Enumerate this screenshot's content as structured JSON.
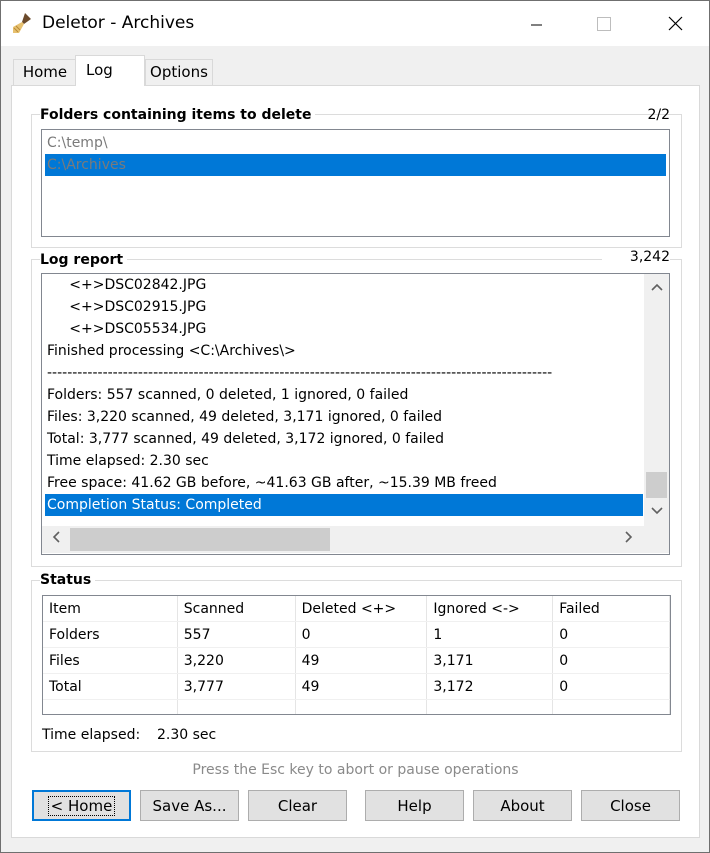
{
  "window": {
    "title": "Deletor - Archives"
  },
  "tabs": [
    {
      "label": "Home",
      "active": false
    },
    {
      "label": "Log",
      "active": true
    },
    {
      "label": "Options",
      "active": false
    }
  ],
  "folders": {
    "label": "Folders containing items to delete",
    "count": "2/2",
    "items": [
      "C:\\temp\\",
      "C:\\Archives"
    ],
    "selected_index": 1
  },
  "log": {
    "label": "Log report",
    "count": "3,242",
    "lines": [
      "     <+>DSC02842.JPG",
      "     <+>DSC02915.JPG",
      "     <+>DSC05534.JPG",
      "Finished processing <C:\\Archives\\>",
      "----------------------------------------------------------------------------------------------------",
      "Folders: 557 scanned, 0 deleted, 1 ignored, 0 failed",
      "Files: 3,220 scanned, 49 deleted, 3,171 ignored, 0 failed",
      "Total: 3,777 scanned, 49 deleted, 3,172 ignored, 0 failed",
      "Time elapsed: 2.30 sec",
      "Free space: 41.62 GB before, ~41.63 GB after, ~15.39 MB freed",
      "Completion Status: Completed"
    ],
    "selected_index": 10
  },
  "status": {
    "label": "Status",
    "columns": [
      "Item",
      "Scanned",
      "Deleted <+>",
      "Ignored <->",
      "Failed"
    ],
    "rows": [
      [
        "Folders",
        "557",
        "0",
        "1",
        "0"
      ],
      [
        "Files",
        "3,220",
        "49",
        "3,171",
        "0"
      ],
      [
        "Total",
        "3,777",
        "49",
        "3,172",
        "0"
      ]
    ],
    "time_label": "Time elapsed:",
    "time_value": "2.30 sec"
  },
  "hint": "Press the Esc key to abort or pause operations",
  "buttons": {
    "home": "< Home",
    "save_as": "Save As...",
    "clear": "Clear",
    "help": "Help",
    "about": "About",
    "close": "Close"
  },
  "colors": {
    "selection": "#0078d7",
    "window_bg": "#f0f0f0",
    "panel_bg": "#ffffff"
  }
}
